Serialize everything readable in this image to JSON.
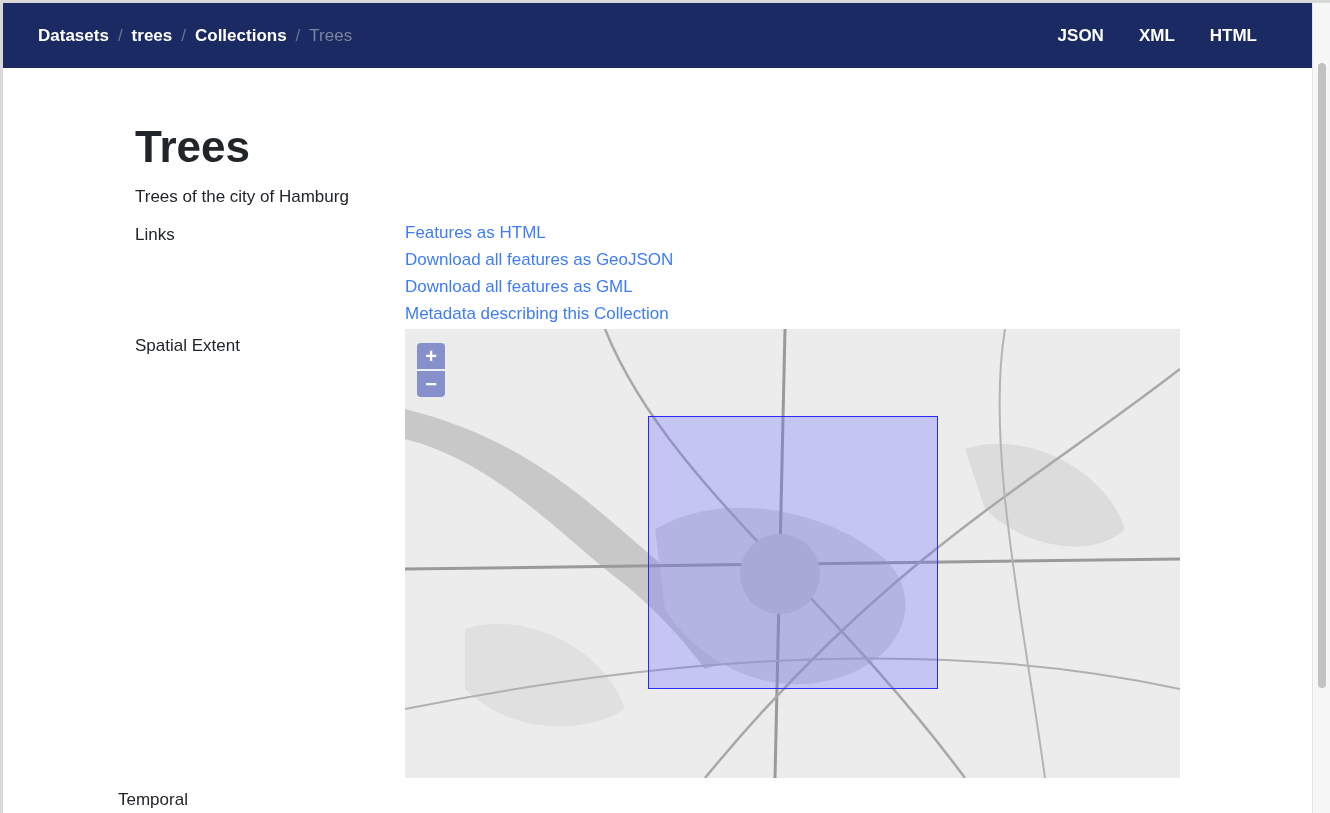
{
  "breadcrumb": [
    {
      "label": "Datasets",
      "current": false
    },
    {
      "label": "trees",
      "current": false
    },
    {
      "label": "Collections",
      "current": false
    },
    {
      "label": "Trees",
      "current": true
    }
  ],
  "breadcrumb_separator": "/",
  "formats": [
    "JSON",
    "XML",
    "HTML"
  ],
  "title": "Trees",
  "description": "Trees of the city of Hamburg",
  "links": {
    "label": "Links",
    "items": [
      "Features as HTML",
      "Download all features as GeoJSON",
      "Download all features as GML",
      "Metadata describing this Collection"
    ]
  },
  "spatial_extent": {
    "label": "Spatial Extent",
    "map": {
      "kind": "picture",
      "zoom_in": "+",
      "zoom_out": "−"
    }
  },
  "temporal": {
    "label": "Temporal"
  }
}
